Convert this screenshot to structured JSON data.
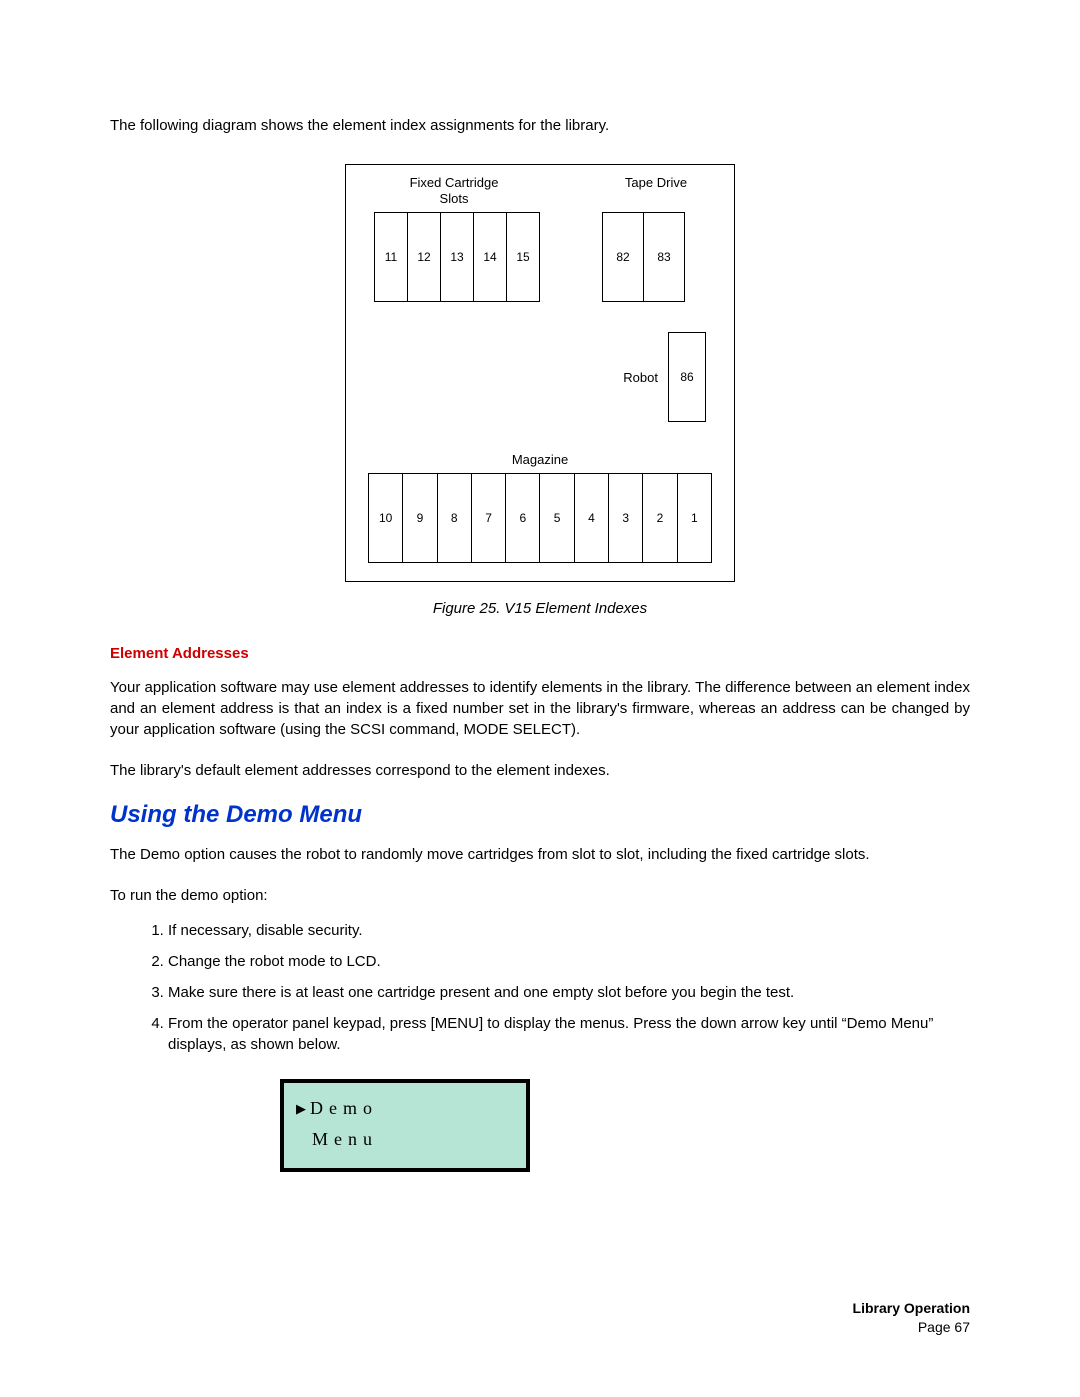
{
  "intro": "The following diagram shows the element index assignments for the library.",
  "diagram": {
    "fixed_label": "Fixed Cartridge\nSlots",
    "tape_label": "Tape Drive",
    "robot_label": "Robot",
    "magazine_label": "Magazine",
    "fixed_slots": [
      "11",
      "12",
      "13",
      "14",
      "15"
    ],
    "tape_drives": [
      "82",
      "83"
    ],
    "robot": "86",
    "magazine_slots": [
      "10",
      "9",
      "8",
      "7",
      "6",
      "5",
      "4",
      "3",
      "2",
      "1"
    ]
  },
  "figure_caption": "Figure 25. V15 Element Indexes",
  "element_addresses": {
    "heading": "Element Addresses",
    "p1": "Your application software may use element addresses to identify elements in the library. The difference between an element index and an element address is that an index is a fixed number set in the library's firmware, whereas an address can be changed by your application software (using the SCSI command, MODE SELECT).",
    "p2": "The library's default element addresses correspond to the element indexes."
  },
  "demo": {
    "heading": "Using the Demo Menu",
    "p1": "The Demo option causes the robot to randomly move cartridges from slot to slot, including the fixed cartridge slots.",
    "p2": "To run the demo option:",
    "steps": [
      "If necessary, disable security.",
      "Change the robot mode to LCD.",
      "Make sure there is at least one cartridge present and one empty slot before you begin the test.",
      "From the operator panel keypad, press [MENU] to display the menus. Press the down arrow key until “Demo Menu” displays, as shown below."
    ],
    "lcd_line1": "Demo",
    "lcd_line2": "Menu"
  },
  "footer": {
    "chapter": "Library Operation",
    "page": "Page 67"
  }
}
